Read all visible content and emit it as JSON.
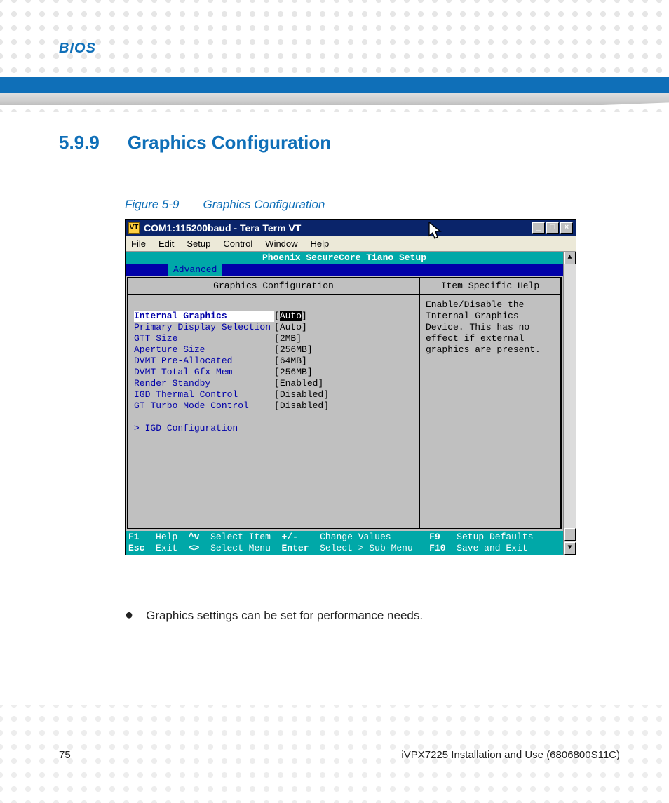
{
  "header": {
    "bios_label": "BIOS"
  },
  "section": {
    "number": "5.9.9",
    "title": "Graphics Configuration"
  },
  "figure": {
    "label": "Figure 5-9",
    "title": "Graphics Configuration"
  },
  "window": {
    "title": "COM1:115200baud - Tera Term VT",
    "menu": {
      "file": "File",
      "edit": "Edit",
      "setup": "Setup",
      "control": "Control",
      "window": "Window",
      "help": "Help"
    }
  },
  "bios": {
    "setup_title": "Phoenix SecureCore Tiano Setup",
    "tab": "Advanced",
    "panel_left_head": "Graphics Configuration",
    "panel_right_head": "Item Specific Help",
    "options": [
      {
        "label": "Internal Graphics",
        "value": "Auto",
        "selected": true
      },
      {
        "label": "Primary Display Selection",
        "value": "Auto",
        "selected": false
      },
      {
        "label": "GTT Size",
        "value": "2MB",
        "selected": false
      },
      {
        "label": "Aperture Size",
        "value": "256MB",
        "selected": false
      },
      {
        "label": "DVMT Pre-Allocated",
        "value": "64MB",
        "selected": false
      },
      {
        "label": "DVMT Total Gfx Mem",
        "value": "256MB",
        "selected": false
      },
      {
        "label": "Render Standby",
        "value": "Enabled",
        "selected": false
      },
      {
        "label": "IGD Thermal Control",
        "value": "Disabled",
        "selected": false
      },
      {
        "label": "GT Turbo Mode Control",
        "value": "Disabled",
        "selected": false
      }
    ],
    "submenu": "IGD Configuration",
    "help_text": "Enable/Disable the Internal Graphics Device.  This has no effect if external graphics are present.",
    "footer": {
      "f1": "F1",
      "help": "Help",
      "updown": "^v",
      "select_item": "Select Item",
      "plusminus": "+/-",
      "change_values": "Change Values",
      "f9": "F9",
      "setup_defaults": "Setup Defaults",
      "esc": "Esc",
      "exit": "Exit",
      "leftright": "<>",
      "select_menu": "Select Menu",
      "enter": "Enter",
      "select_submenu": "Select > Sub-Menu",
      "f10": "F10",
      "save_exit": "Save and Exit"
    }
  },
  "bullet": "Graphics settings can be set for performance needs.",
  "pagefoot": {
    "page": "75",
    "doc": "iVPX7225 Installation and Use (6806800S11C)"
  }
}
